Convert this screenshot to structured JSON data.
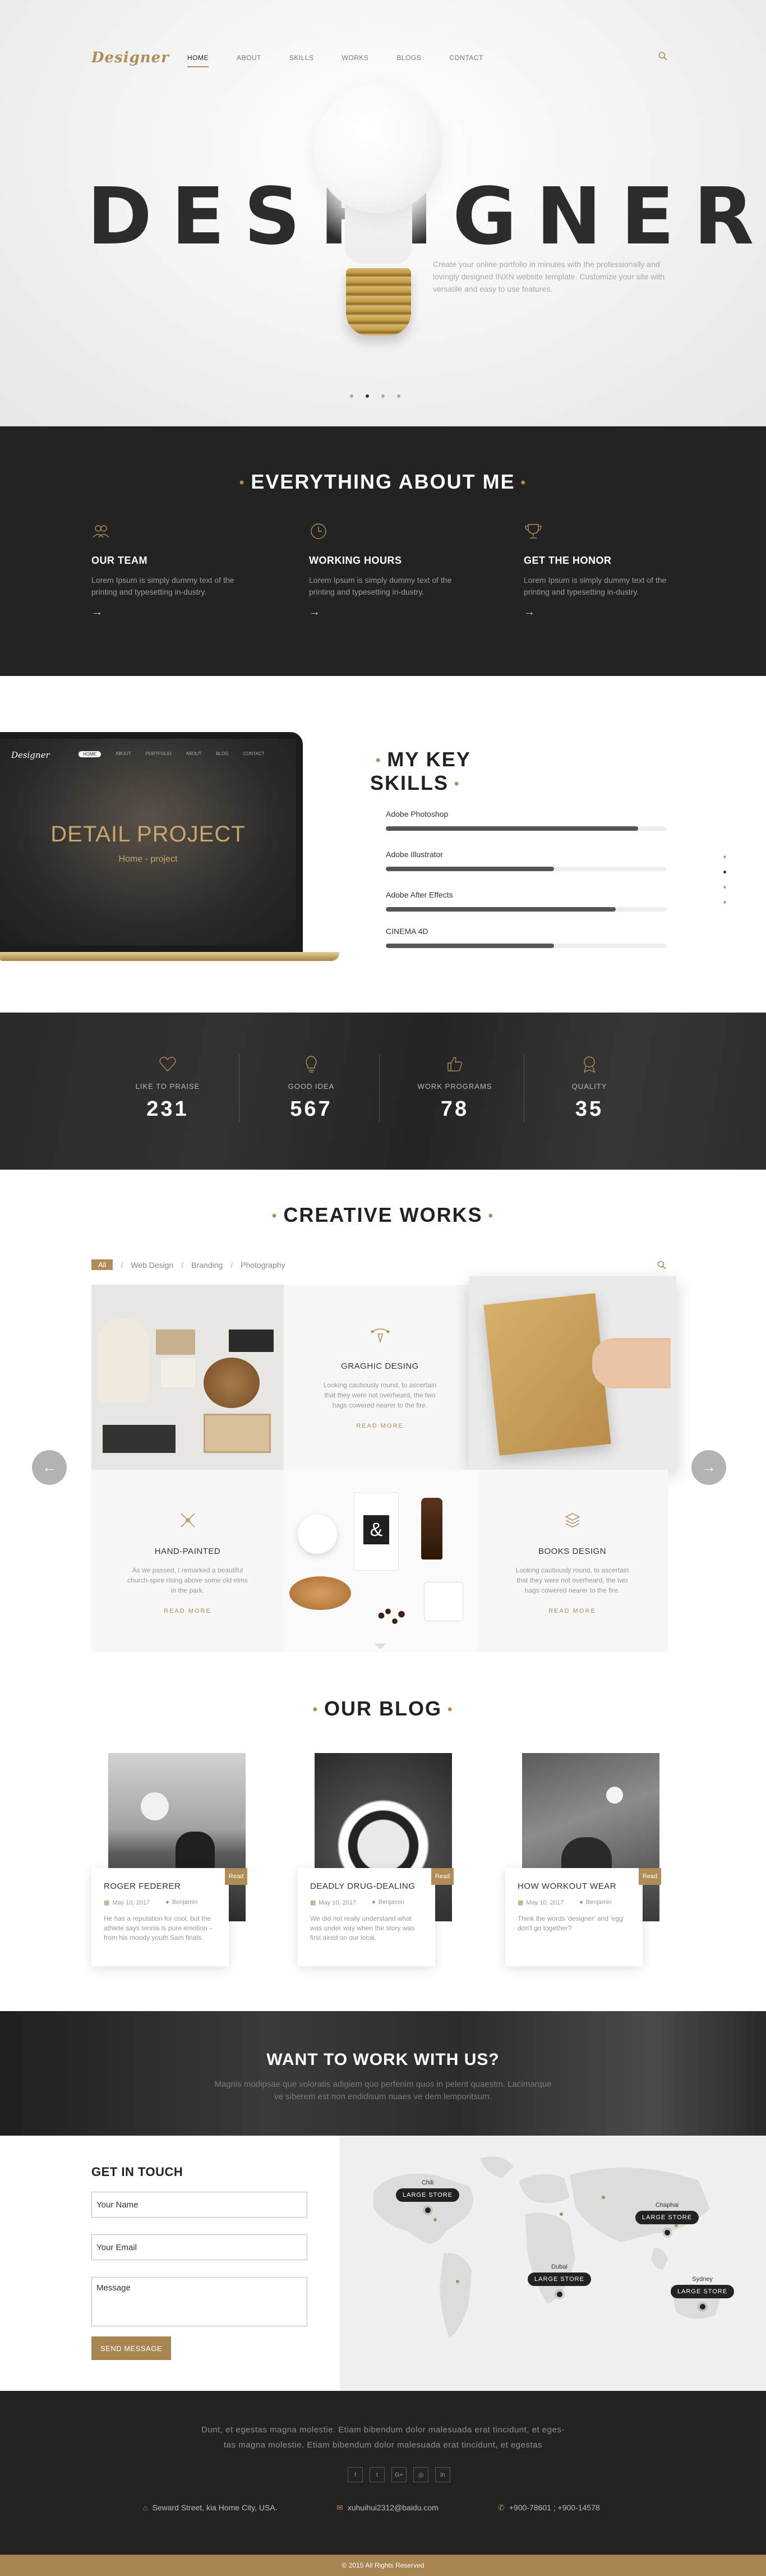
{
  "header": {
    "logo": "Designer",
    "nav": [
      {
        "label": "HOME",
        "active": true
      },
      {
        "label": "ABOUT",
        "active": false
      },
      {
        "label": "SKILLS",
        "active": false
      },
      {
        "label": "WORKS",
        "active": false
      },
      {
        "label": "BLOGS",
        "active": false
      },
      {
        "label": "CONTACT",
        "active": false
      }
    ],
    "search_icon": "search-icon"
  },
  "hero": {
    "title": "DESHIGNER",
    "description": "Create your online portfolio in minutes with the professionally and lovingly designed INXN website template. Customize your site with versatile and easy to use features.",
    "slide_count": 4,
    "active_slide": 1
  },
  "about": {
    "title": "EVERYTHING ABOUT ME",
    "items": [
      {
        "icon": "team-icon",
        "title": "OUR TEAM",
        "text": "Lorem Ipsum is simply dummy text of the printing and typesetting in-dustry."
      },
      {
        "icon": "clock-icon",
        "title": "WORKING HOURS",
        "text": "Lorem Ipsum is simply dummy text of the printing and typesetting in-dustry."
      },
      {
        "icon": "trophy-icon",
        "title": "GET THE HONOR",
        "text": "Lorem Ipsum is simply dummy text of the printing and typesetting in-dustry."
      }
    ]
  },
  "skills": {
    "title": "MY KEY SKILLS",
    "laptop": {
      "logo": "Designer",
      "nav": [
        "HOME",
        "ABOUT",
        "PORTFOLIO",
        "ABOUT",
        "BLOG",
        "CONTACT"
      ],
      "title": "DETAIL PROJECT",
      "subtitle": "Home - project"
    },
    "items": [
      {
        "label": "Adobe Photoshop",
        "level": 0.9
      },
      {
        "label": "Adobe Illustrator",
        "level": 0.6
      },
      {
        "label": "Adobe After Effects",
        "level": 0.82
      },
      {
        "label": "CINEMA 4D",
        "level": 0.6
      }
    ]
  },
  "stats": [
    {
      "icon": "heart-icon",
      "label": "LIKE TO PRAISE",
      "value": "231"
    },
    {
      "icon": "lightbulb-icon",
      "label": "GOOD IDEA",
      "value": "567"
    },
    {
      "icon": "thumbs-up-icon",
      "label": "WORK PROGRAMS",
      "value": "78"
    },
    {
      "icon": "award-icon",
      "label": "QUALITY",
      "value": "35"
    }
  ],
  "works": {
    "title": "CREATIVE WORKS",
    "filters": [
      "All",
      "Web Design",
      "Branding",
      "Photography"
    ],
    "tiles": [
      {
        "title": "GRAGHIC DESING",
        "text": "Looking cautiously round, to ascertain that they were not overheard, the two hags cowered nearer to the fire.",
        "more": "READ MORE",
        "icon": "graphic-icon"
      },
      {
        "title": "HAND-PAINTED",
        "text": "As we passed, I remarked a beautiful church-spire rising above some old elms in the park.",
        "more": "READ MORE",
        "icon": "brush-icon"
      },
      {
        "title": "BOOKS DESIGN",
        "text": "Looking cautiously round, to ascertain that they were not overheard, the two hags cowered nearer to the fire.",
        "more": "READ MORE",
        "icon": "books-icon"
      }
    ]
  },
  "blog": {
    "title": "OUR BLOG",
    "posts": [
      {
        "title": "ROGER FEDERER",
        "date": "May 10, 2017",
        "author": "Benjamin",
        "text": "He has a reputation for cool, but the athlete says tennis is pure emotion – from his moody youth Sam finals.",
        "read": "Read"
      },
      {
        "title": "DEADLY DRUG-DEALING",
        "date": "May 10, 2017",
        "author": "Benjamin",
        "text": "We did not really understand what was under way when the story was first aired on our local.",
        "read": "Read"
      },
      {
        "title": "HOW WORKOUT WEAR",
        "date": "May 10, 2017",
        "author": "Benjamin",
        "text": "Think the words 'designer' and 'egg' don't go together?",
        "read": "Read"
      }
    ]
  },
  "cta": {
    "title": "WANT TO WORK WITH US?",
    "text": "Magnis modipsae que voloratis adigiem quo perfenim quos in pelent quaestm. Lacimarque ve siberem est non endidisum nuaes ve dem lemporitsum."
  },
  "contact": {
    "title": "GET IN TOUCH",
    "name_placeholder": "Your Name",
    "email_placeholder": "Your Email",
    "message_placeholder": "Message",
    "send_label": "SEND MESSAGE",
    "stores": [
      {
        "city": "Chili",
        "label": "LARGE STORE"
      },
      {
        "city": "Chaphai",
        "label": "LARGE STORE"
      },
      {
        "city": "Dubai",
        "label": "LARGE STORE"
      },
      {
        "city": "Sydney",
        "label": "LARGE STORE"
      }
    ]
  },
  "footer": {
    "text_line1": "Dunt, et egestas magna molestie. Etiam bibendum dolor malesuada erat tincidunt, et eges-",
    "text_line2": "tas magna molestie. Etiam bibendum dolor malesuada erat tincidunt, et egestas",
    "socials": [
      "f",
      "t",
      "G+",
      "◎",
      "in"
    ],
    "address": "Seward Street, kia Home City, USA.",
    "email": "xuhuihui2312@baidu.com",
    "phone": "+900-78601 ; +900-14578",
    "copyright": "© 2015 All Rights Reserved"
  },
  "colors": {
    "accent": "#b08d57",
    "dark": "#232323"
  }
}
